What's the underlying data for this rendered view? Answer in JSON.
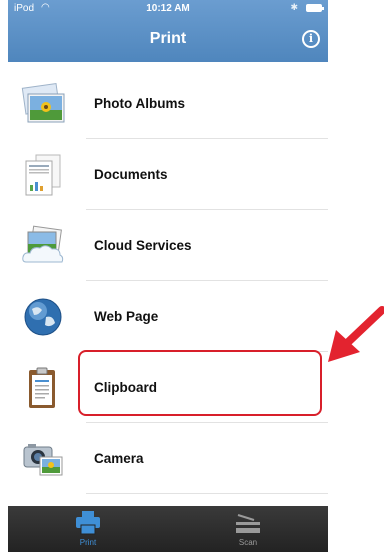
{
  "status_bar": {
    "carrier": "iPod",
    "time": "10:12 AM"
  },
  "nav": {
    "title": "Print",
    "info_icon": "info-icon"
  },
  "menu": {
    "items": [
      {
        "label": "Photo Albums",
        "icon": "photo-albums-icon"
      },
      {
        "label": "Documents",
        "icon": "documents-icon"
      },
      {
        "label": "Cloud Services",
        "icon": "cloud-services-icon"
      },
      {
        "label": "Web Page",
        "icon": "globe-icon"
      },
      {
        "label": "Clipboard",
        "icon": "clipboard-icon"
      },
      {
        "label": "Camera",
        "icon": "camera-icon"
      }
    ]
  },
  "tabs": [
    {
      "label": "Print",
      "icon": "printer-icon",
      "selected": true
    },
    {
      "label": "Scan",
      "icon": "scanner-icon",
      "selected": false
    }
  ],
  "colors": {
    "nav_bar": "#5a8fc4",
    "highlight": "#d81f2a",
    "tab_active": "#3f8fd6",
    "tab_inactive": "#9a9a9a",
    "tab_bar": "#2c2c2c"
  }
}
